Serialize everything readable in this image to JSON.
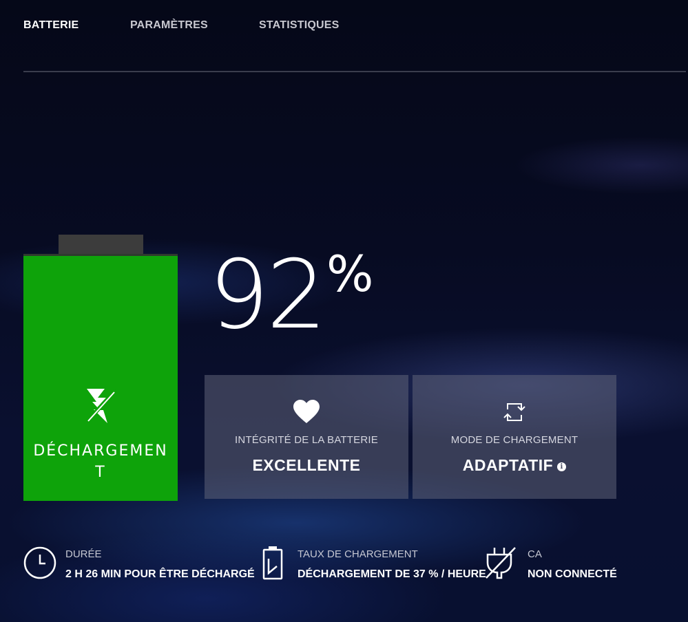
{
  "tabs": [
    {
      "label": "BATTERIE",
      "active": true
    },
    {
      "label": "PARAMÈTRES",
      "active": false
    },
    {
      "label": "STATISTIQUES",
      "active": false
    }
  ],
  "battery": {
    "percent": "92",
    "percent_unit": "%",
    "level": 0.92,
    "status": "DÉCHARGEMENT",
    "color": "#0ea30a"
  },
  "cards": [
    {
      "icon": "heart-icon",
      "label": "INTÉGRITÉ DE LA BATTERIE",
      "value": "EXCELLENTE"
    },
    {
      "icon": "refresh-icon",
      "label": "MODE DE CHARGEMENT",
      "value": "ADAPTATIF",
      "info_icon": "info-icon",
      "info_glyph": "i"
    }
  ],
  "stats": [
    {
      "icon": "clock-icon",
      "label": "DURÉE",
      "value": "2 H 26 MIN POUR ÊTRE DÉCHARGÉ"
    },
    {
      "icon": "battery-charging-icon",
      "label": "TAUX DE CHARGEMENT",
      "value": "DÉCHARGEMENT DE 37 % / HEURE"
    },
    {
      "icon": "plug-off-icon",
      "label": "CA",
      "value": "NON CONNECTÉ"
    }
  ]
}
